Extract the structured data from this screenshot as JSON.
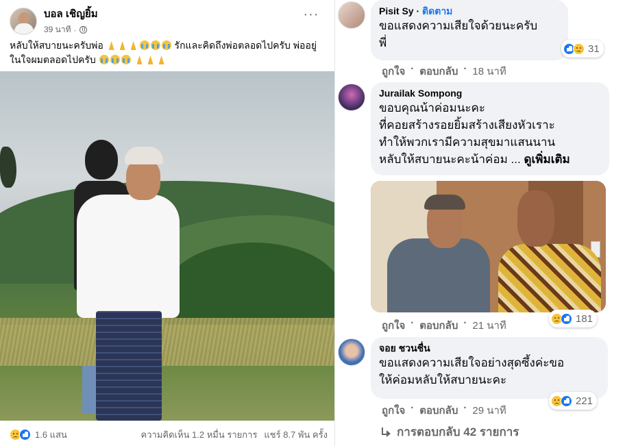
{
  "post": {
    "author": "บอล เชิญยิ้ม",
    "time": "39 นาที",
    "text_part1": "หลับให้สบายนะครับพ่อ",
    "text_part2": "รักและคิดถึงพ่อตลอดไปครับ พ่ออยู่ในใจผมตลอดไปครับ",
    "reaction_icons": [
      "sad",
      "like"
    ],
    "reactions_count": "1.6 แสน",
    "comments_count": "ความคิดเห็น 1.2 หมื่น รายการ",
    "shares_count": "แชร์ 8.7 พัน ครั้ง"
  },
  "comments": [
    {
      "name": "Pisit Sy",
      "follow": "ติดตาม",
      "text_lines": [
        "ขอแสดงความเสียใจด้วยนะครับ",
        "พี่"
      ],
      "reactions": [
        "like",
        "sad"
      ],
      "reaction_count": "31",
      "like_label": "ถูกใจ",
      "reply_label": "ตอบกลับ",
      "time": "18 นาที"
    },
    {
      "name": "Jurailak Sompong",
      "text_lines": [
        "ขอบคุณน้าค่อมนะคะ",
        "ที่คอยสร้างรอยยิ้มสร้างเสียงหัวเราะ",
        "ทำให้พวกเรามีความสุขมาแสนนาน",
        "หลับให้สบายนะคะน้าค่อม ..."
      ],
      "see_more": "ดูเพิ่มเติม",
      "reactions": [
        "sad",
        "like"
      ],
      "reaction_count": "181",
      "like_label": "ถูกใจ",
      "reply_label": "ตอบกลับ",
      "time": "21 นาที"
    },
    {
      "name": "จอย ชวนชื่น",
      "text_lines": [
        "ขอแสดงความเสียใจอย่างสุดซึ้งค่ะขอ",
        "ให้ค่อมหลับให้สบายนะคะ"
      ],
      "reactions": [
        "sad",
        "like"
      ],
      "reaction_count": "221",
      "like_label": "ถูกใจ",
      "reply_label": "ตอบกลับ",
      "time": "29 นาที"
    }
  ],
  "replies_link": "การตอบกลับ 42 รายการ",
  "colors": {
    "accent": "#1877f2",
    "bubble": "#f0f2f5",
    "secondary_text": "#65676b"
  }
}
